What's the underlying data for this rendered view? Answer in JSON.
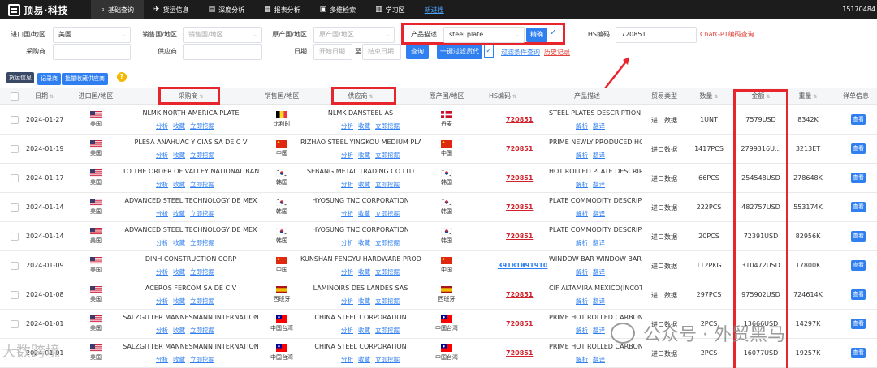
{
  "app": {
    "logo": "顶易·科技",
    "user_id": "15170484"
  },
  "nav": [
    {
      "label": "基础查询",
      "icon": "search-icon",
      "active": true
    },
    {
      "label": "货运信息",
      "icon": "plane-icon"
    },
    {
      "label": "深度分析",
      "icon": "chart-icon"
    },
    {
      "label": "报表分析",
      "icon": "report-icon"
    },
    {
      "label": "多维检索",
      "icon": "grid-icon"
    },
    {
      "label": "学习区",
      "icon": "book-icon"
    },
    {
      "label": "新进搜"
    }
  ],
  "filters": {
    "import_country_label": "进口国/地区",
    "import_country_value": "美国",
    "sales_country_label": "销售国/地区",
    "sales_country_placeholder": "销售国/地区",
    "origin_country_label": "原产国/地区",
    "origin_country_placeholder": "原产国/地区",
    "product_label": "产品描述",
    "product_value": "steel plate",
    "exact_label": "精确",
    "hs_label": "HS编码",
    "hs_value": "720851",
    "chatgpt_link": "ChatGPT编码查询",
    "buyer_label": "采购商",
    "supplier_label": "供应商",
    "date_label": "日期",
    "date_start": "开始日期",
    "date_sep": "至",
    "date_end": "结束日期",
    "query_button": "查询",
    "one_click_button": "一键过滤货代",
    "filter_link": "过滤条件查询",
    "history_link": "历史记录"
  },
  "actions": {
    "side_tag": "货运信息",
    "btn1": "记录商",
    "btn2": "批量收藏供应商",
    "warn": "?"
  },
  "table": {
    "headers": [
      "日期",
      "进口国/地区",
      "采购商",
      "销售国/地区",
      "供应商",
      "原产国/地区",
      "HS编码",
      "产品描述",
      "贸易类型",
      "数量",
      "金额",
      "重量",
      "详单信息"
    ],
    "ops_buyer": [
      "分析",
      "收藏",
      "立即挖掘"
    ],
    "ops_product": [
      "解析",
      "翻译"
    ],
    "view_label": "查看",
    "rows": [
      {
        "date": "2024-01-27",
        "imp": "美国",
        "buyer": "NLMK NORTH AMERICA PLATE",
        "sales": "比利时",
        "supplier": "NLMK DANSTEEL AS",
        "origin": "丹麦",
        "hs": [
          "720851"
        ],
        "product": "STEEL PLATES DESCRIPTION:",
        "trade": "进口数据",
        "qty": "1UNT",
        "amount": "7579USD",
        "weight": "8342K"
      },
      {
        "date": "2024-01-19",
        "imp": "美国",
        "buyer": "PLESA ANAHUAC Y CIAS SA DE C V",
        "sales": "中国",
        "supplier": "RIZHAO STEEL YINGKOU MEDIUM PLAT",
        "origin": "中国",
        "hs": [
          "720851"
        ],
        "product": "PRIME NEWLY PRODUCED HO",
        "trade": "进口数据",
        "qty": "1417PCS",
        "amount": "2799316U...",
        "weight": "3213ET"
      },
      {
        "date": "2024-01-17",
        "imp": "美国",
        "buyer": "TO THE ORDER OF VALLEY NATIONAL BAN",
        "sales": "韩国",
        "supplier": "SEBANG METAL TRADING CO LTD",
        "origin": "韩国",
        "hs": [
          "720851"
        ],
        "product": "HOT ROLLED PLATE DESCRIPT",
        "trade": "进口数据",
        "qty": "66PCS",
        "amount": "254548USD",
        "weight": "278648K"
      },
      {
        "date": "2024-01-14",
        "imp": "美国",
        "buyer": "ADVANCED STEEL TECHNOLOGY DE MEX",
        "sales": "韩国",
        "supplier": "HYOSUNG TNC CORPORATION",
        "origin": "韩国",
        "hs": [
          "720851"
        ],
        "product": "PLATE COMMODITY DESCRIPT",
        "trade": "进口数据",
        "qty": "222PCS",
        "amount": "482757USD",
        "weight": "553174K"
      },
      {
        "date": "2024-01-14",
        "imp": "美国",
        "buyer": "ADVANCED STEEL TECHNOLOGY DE MEX",
        "sales": "韩国",
        "supplier": "HYOSUNG TNC CORPORATION",
        "origin": "韩国",
        "hs": [
          "720851"
        ],
        "product": "PLATE COMMODITY DESCRIPT",
        "trade": "进口数据",
        "qty": "20PCS",
        "amount": "72391USD",
        "weight": "82956K"
      },
      {
        "date": "2024-01-09",
        "imp": "美国",
        "buyer": "DINH CONSTRUCTION CORP",
        "sales": "中国",
        "supplier": "KUNSHAN FENGYU HARDWARE PRODU",
        "origin": "中国",
        "hs": [
          "391810",
          "391910"
        ],
        "product": "WINDOW BAR WINDOW BAR H",
        "trade": "进口数据",
        "qty": "112PKG",
        "amount": "310472USD",
        "weight": "17800K"
      },
      {
        "date": "2024-01-08",
        "imp": "美国",
        "buyer": "ACEROS FERCOM SA DE C V",
        "sales": "西班牙",
        "supplier": "LAMINOIRS DES LANDES SAS",
        "origin": "西班牙",
        "hs": [
          "720851"
        ],
        "product": "CIF ALTAMIRA MEXICO(INCOTE",
        "trade": "进口数据",
        "qty": "297PCS",
        "amount": "975902USD",
        "weight": "724614K"
      },
      {
        "date": "2024-01-01",
        "imp": "美国",
        "buyer": "SALZGITTER MANNESMANN INTERNATION",
        "sales": "中国台湾",
        "supplier": "CHINA STEEL CORPORATION",
        "origin": "中国台湾",
        "hs": [
          "720851"
        ],
        "product": "PRIME HOT ROLLED CARBON",
        "trade": "进口数据",
        "qty": "2PCS",
        "amount": "13666USD",
        "weight": "14297K"
      },
      {
        "date": "2024-01-01",
        "imp": "美国",
        "buyer": "SALZGITTER MANNESMANN INTERNATION",
        "sales": "中国台湾",
        "supplier": "CHINA STEEL CORPORATION",
        "origin": "中国台湾",
        "hs": [
          "720851"
        ],
        "product": "PRIME HOT ROLLED CARBON",
        "trade": "进口数据",
        "qty": "2PCS",
        "amount": "16077USD",
        "weight": "19257K"
      }
    ]
  },
  "watermark": {
    "main": "公众号 · 外贸黑马",
    "left": "大数跨境"
  }
}
